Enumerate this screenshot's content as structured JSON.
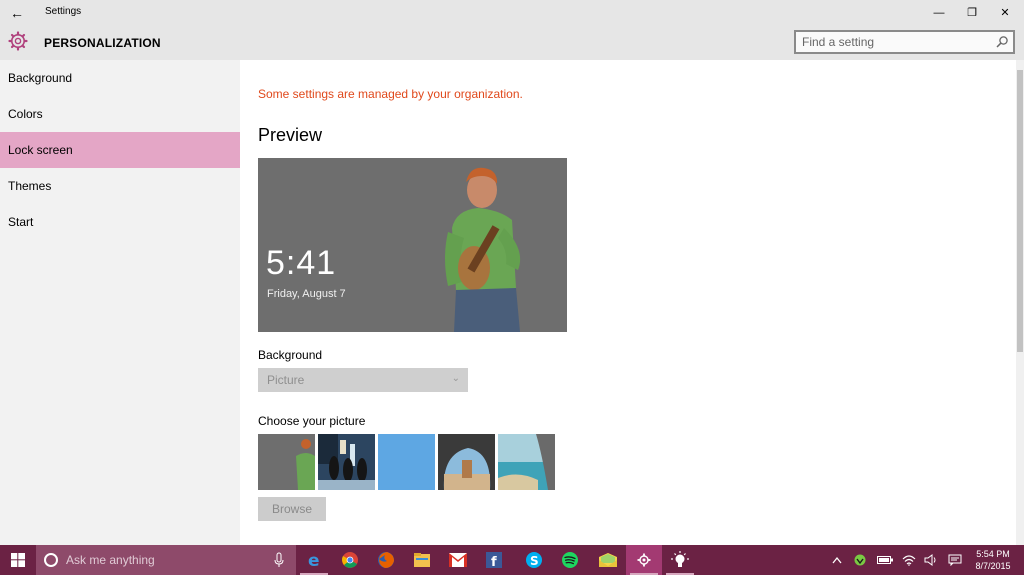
{
  "window": {
    "title": "Settings",
    "minimize_glyph": "—",
    "restore_glyph": "❐",
    "close_glyph": "✕",
    "back_glyph": "←"
  },
  "header": {
    "title": "PERSONALIZATION",
    "search_placeholder": "Find a setting",
    "icon": "gear-icon"
  },
  "sidebar": {
    "items": [
      {
        "label": "Background",
        "active": false
      },
      {
        "label": "Colors",
        "active": false
      },
      {
        "label": "Lock screen",
        "active": true
      },
      {
        "label": "Themes",
        "active": false
      },
      {
        "label": "Start",
        "active": false
      }
    ]
  },
  "main": {
    "org_notice": "Some settings are managed by your organization.",
    "preview_title": "Preview",
    "preview": {
      "time": "5:41",
      "date": "Friday, August 7"
    },
    "background_label": "Background",
    "background_value": "Picture",
    "choose_label": "Choose your picture",
    "browse_label": "Browse"
  },
  "taskbar": {
    "search_placeholder": "Ask me anything",
    "apps": [
      "edge-icon",
      "chrome-icon",
      "firefox-icon",
      "file-explorer-icon",
      "gmail-icon",
      "facebook-icon",
      "skype-icon",
      "spotify-icon",
      "mail-icon",
      "settings-icon",
      "tips-icon"
    ],
    "clock_time": "5:54 PM",
    "clock_date": "8/7/2015"
  },
  "colors": {
    "accent": "#e4a6c6",
    "taskbar": "#6b2244",
    "notice": "#e0491c"
  }
}
